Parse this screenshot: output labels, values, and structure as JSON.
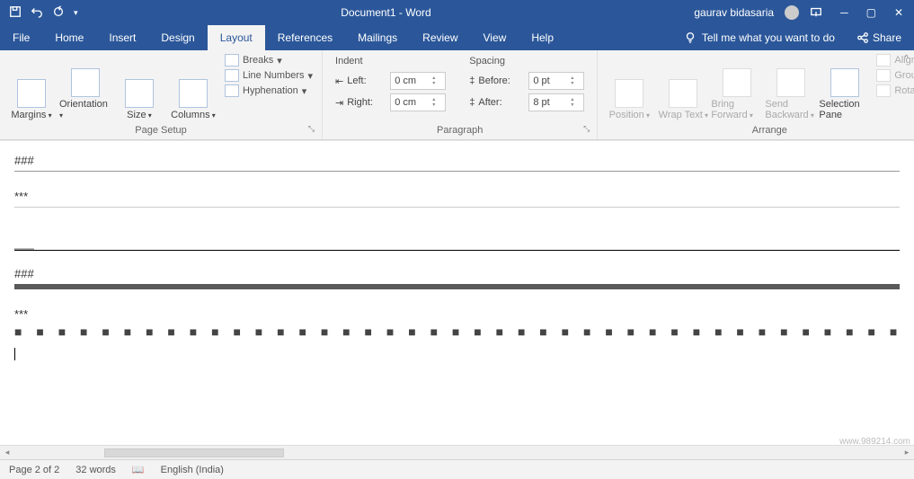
{
  "title": "Document1 - Word",
  "user": "gaurav bidasaria",
  "tellme": "Tell me what you want to do",
  "share": "Share",
  "tabs": [
    "File",
    "Home",
    "Insert",
    "Design",
    "Layout",
    "References",
    "Mailings",
    "Review",
    "View",
    "Help"
  ],
  "activeTab": "Layout",
  "ribbon": {
    "pagesetup": {
      "label": "Page Setup",
      "margins": "Margins",
      "orientation": "Orientation",
      "size": "Size",
      "columns": "Columns",
      "breaks": "Breaks",
      "lineNumbers": "Line Numbers",
      "hyphenation": "Hyphenation"
    },
    "paragraph": {
      "label": "Paragraph",
      "indent": "Indent",
      "spacing": "Spacing",
      "leftLbl": "Left:",
      "rightLbl": "Right:",
      "beforeLbl": "Before:",
      "afterLbl": "After:",
      "leftVal": "0 cm",
      "rightVal": "0 cm",
      "beforeVal": "0 pt",
      "afterVal": "8 pt"
    },
    "arrange": {
      "label": "Arrange",
      "position": "Position",
      "wrap": "Wrap Text",
      "bringFwd": "Bring Forward",
      "sendBack": "Send Backward",
      "selPane": "Selection Pane",
      "align": "Align",
      "group": "Group",
      "rotate": "Rotate"
    }
  },
  "doc": {
    "l1": "###",
    "l2": "***",
    "l3": "___",
    "l4": "###",
    "l5": "***"
  },
  "status": {
    "page": "Page 2 of 2",
    "words": "32 words",
    "lang": "English (India)"
  },
  "watermark": "www.989214.com"
}
